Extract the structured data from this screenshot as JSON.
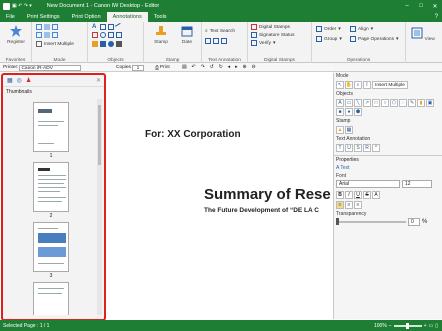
{
  "title_bar": {
    "title": "New Document 1 - Canon IW Desktop - Editor",
    "minimize": "–",
    "maximize": "□",
    "close": "✕"
  },
  "tabs": [
    "File",
    "Print Settings",
    "Print Option",
    "Annotations",
    "Tools"
  ],
  "active_tab": "Annotations",
  "ribbon": {
    "register": "Register",
    "favorites": "Favorites",
    "insert_multiple": "Insert Multiple",
    "mode": "Mode",
    "objects": "Objects",
    "stamp": "Stamp",
    "date": "Date",
    "stamp_group": "Stamp",
    "text_search": "Text Search",
    "text_annotation": "Text Annotation",
    "digital_stamps": "Digital Stamps",
    "signature_status": "Signature Status",
    "verify": "Verify",
    "digital_stamps_group": "Digital Stamps",
    "order": "Order",
    "group": "Group",
    "align": "Align",
    "page_operations": "Page Operations",
    "operations": "Operations",
    "view": "View"
  },
  "toolbar": {
    "printer_label": "Printer:",
    "printer_value": "Canon iR-ADV",
    "copies_label": "Copies",
    "copies_value": "1",
    "print_btn": "Print",
    "display_annotations": "Display Annotations"
  },
  "left_pane": {
    "title": "Thumbnails",
    "pages": [
      "1",
      "2",
      "3"
    ]
  },
  "document": {
    "for_line": "For: XX Corporation",
    "summary": "Summary of Rese",
    "subtitle": "The Future Development of “DE LA C"
  },
  "right_pane": {
    "mode": "Mode",
    "insert_multiple": "Insert Multiple",
    "objects": "Objects",
    "stamp": "Stamp",
    "text_annotation": "Text Annotation",
    "properties": "Properties",
    "text_label": "Text",
    "font_label": "Font",
    "font_value": "Arial",
    "size_value": "12",
    "transparency_label": "Transparency",
    "transparency_value": "0",
    "percent": "%"
  },
  "status_bar": {
    "selected_page": "Selected Page : 1 / 1",
    "zoom": "100%"
  },
  "colors": {
    "accent": "#1e7e34",
    "highlight": "#e0201f"
  }
}
